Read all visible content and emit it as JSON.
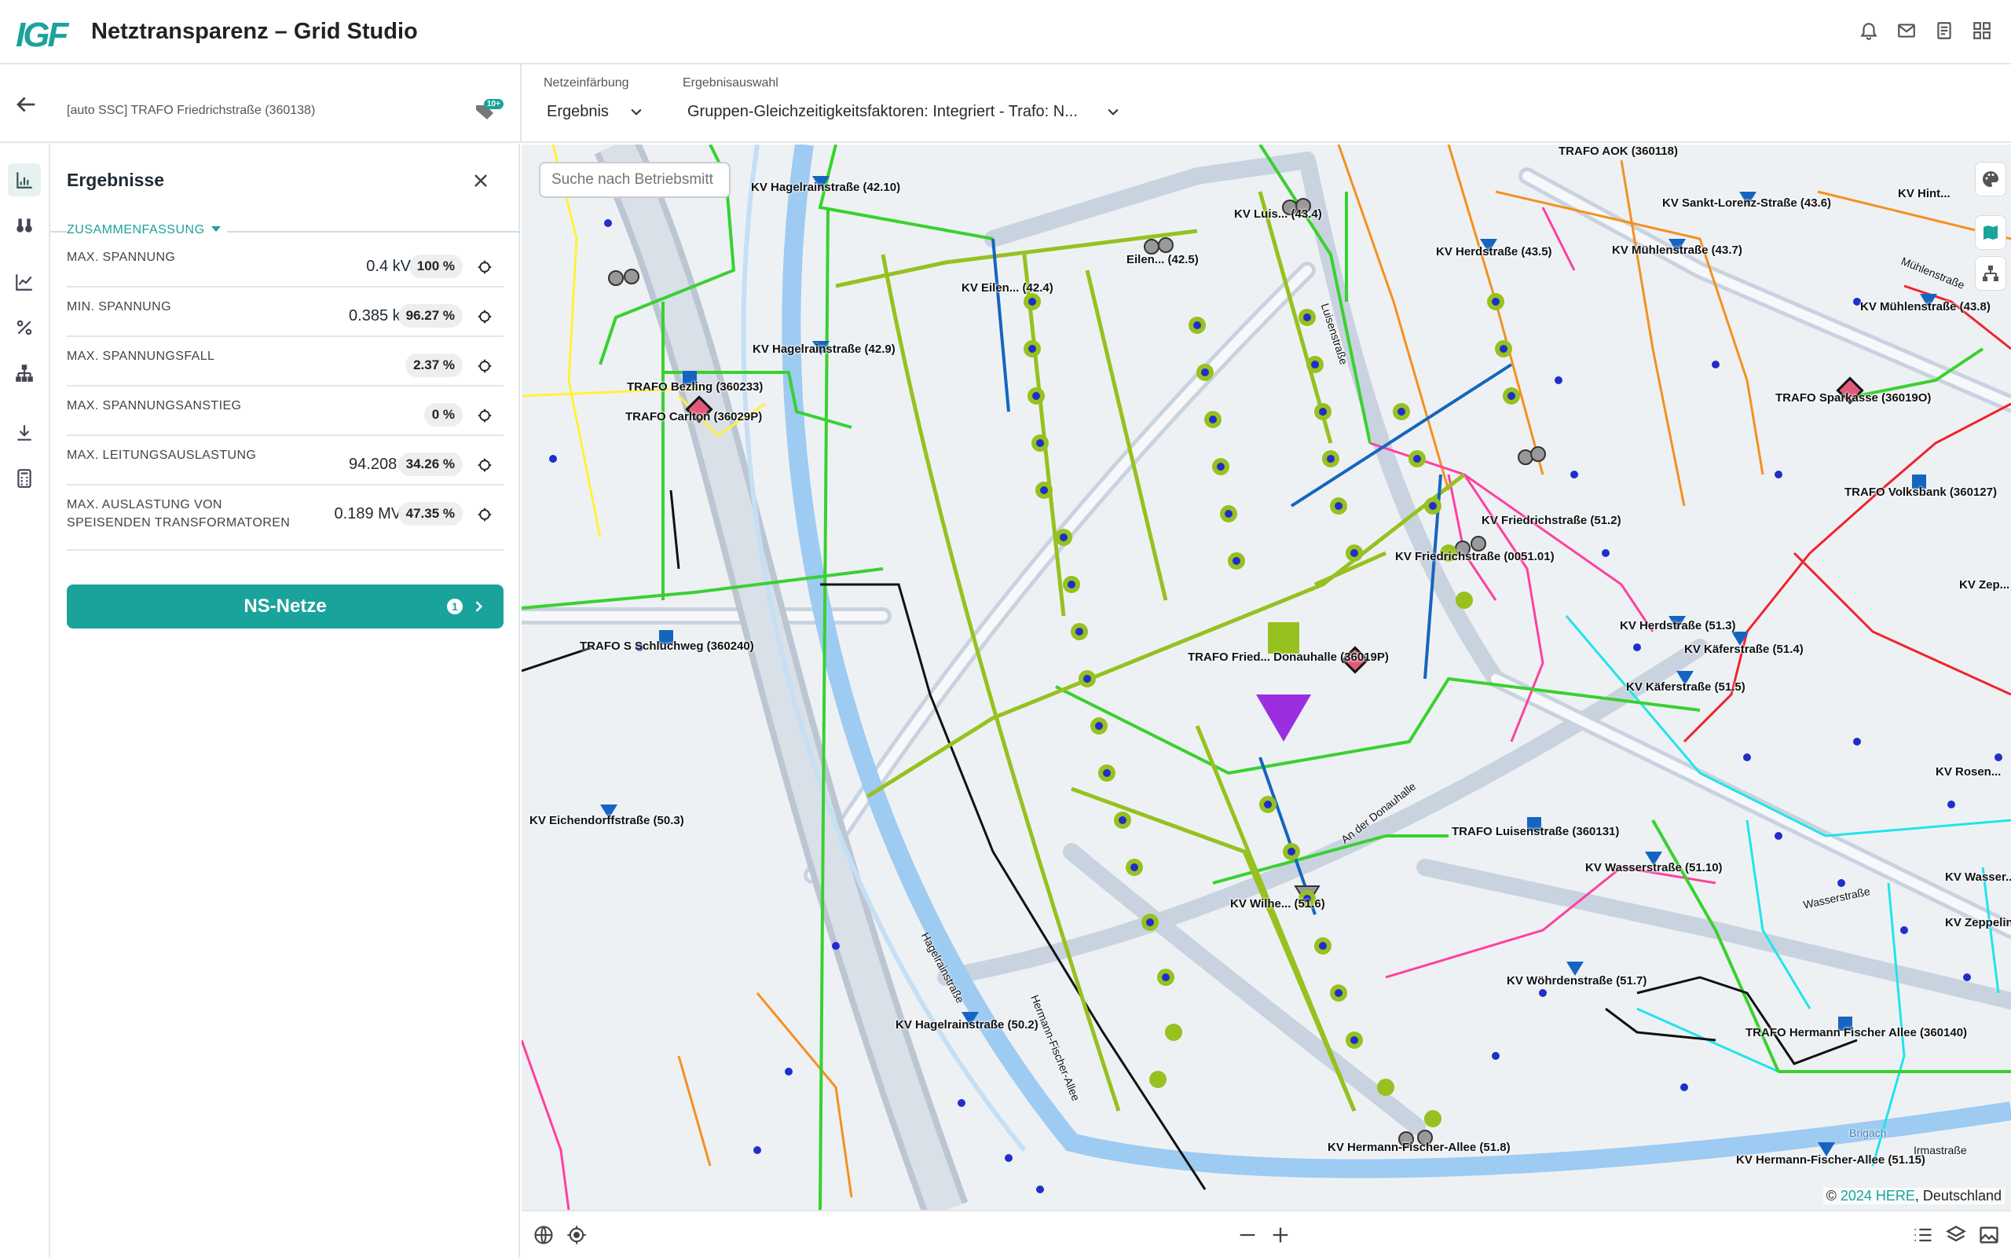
{
  "app": {
    "logo": "IGF",
    "title": "Netztransparenz – Grid Studio"
  },
  "header_icons": [
    "bell-icon",
    "mail-icon",
    "document-icon",
    "apps-grid-icon"
  ],
  "context": {
    "label": "[auto SSC] TRAFO Friedrichstraße (360138)",
    "badge": "10+"
  },
  "selectors": {
    "netzeinfaerbung": {
      "label": "Netzeinfärbung",
      "value": "Ergebnis"
    },
    "ergebnisauswahl": {
      "label": "Ergebnisauswahl",
      "value": "Gruppen-Gleichzeitigkeitsfaktoren: Integriert - Trafo: N..."
    }
  },
  "panel": {
    "title": "Ergebnisse",
    "section": "ZUSAMMENFASSUNG",
    "metrics": [
      {
        "label": "MAX. SPANNUNG",
        "value": "0.4 kV",
        "pct": "100 %"
      },
      {
        "label": "MIN. SPANNUNG",
        "value": "0.385 kV",
        "pct": "96.27 %"
      },
      {
        "label": "MAX. SPANNUNGSFALL",
        "value": "",
        "pct": "2.37 %"
      },
      {
        "label": "MAX. SPANNUNGSANSTIEG",
        "value": "",
        "pct": "0 %"
      },
      {
        "label": "MAX. LEITUNGSAUSLASTUNG",
        "value": "94.208 A",
        "pct": "34.26 %"
      },
      {
        "label": "MAX. AUSLASTUNG VON SPEISENDEN TRANSFORMATOREN",
        "label_line1": "MAX. AUSLASTUNG VON",
        "label_line2": "SPEISENDEN TRANSFORMATOREN",
        "value": "0.189 MVA",
        "pct": "47.35 %"
      }
    ],
    "ns_button": {
      "label": "NS-Netze",
      "count": "1"
    }
  },
  "map": {
    "search_placeholder": "Suche nach Betriebsmitt",
    "copyright_prefix": "© ",
    "copyright_brand": "2024 HERE",
    "copyright_suffix": ", Deutschland",
    "labels": {
      "l1": "KV Hagelrainstraße (42.10)",
      "l2": "KV Eilen... (42.4)",
      "l3": "Eilen... (42.5)",
      "l4": "KV Luis... (43.4)",
      "l5": "TRAFO AOK (360118)",
      "l6": "KV Sankt-Lorenz-Straße (43.6)",
      "l7": "KV Herdstraße (43.5)",
      "l8": "KV Mühlenstraße (43.7)",
      "l9": "KV Mühlenstraße (43.8)",
      "l10": "KV Hagelrainstraße (42.9)",
      "l11": "TRAFO Bezling (360233)",
      "l12": "TRAFO Carlton (36029P)",
      "l13": "TRAFO Sparkasse (36019O)",
      "l14": "TRAFO Volksbank (360127)",
      "l15": "KV Friedrichstraße (51.2)",
      "l16": "KV Friedrichstraße (0051.01)",
      "l17": "TRAFO S Schluchweg (360240)",
      "l18": "TRAFO Fried... Donauhalle (36019P)",
      "l19": "KV Herdstraße (51.3)",
      "l20": "KV Käferstraße (51.4)",
      "l21": "KV Käferstraße (51.5)",
      "l22": "KV Eichendorffstraße (50.3)",
      "l23": "TRAFO Luisenstraße (360131)",
      "l24": "KV Wasserstraße (51.10)",
      "l25": "KV Wilhe... (51.6)",
      "l26": "KV Wöhrdenstraße (51.7)",
      "l27": "KV Hagelrainstraße (50.2)",
      "l28": "TRAFO Hermann Fischer Allee (360140)",
      "l29": "KV Hermann-Fischer-Allee (51.8)",
      "l30": "KV Hermann-Fischer-Allee (51.15)",
      "l31": "KV Rosen...",
      "l32": "KV Zeppelin",
      "l33": "KV Wasser...",
      "l34": "KV Hint...",
      "l35": "KV Zep..."
    },
    "streets": {
      "s1": "Hermann-Fischer-Allee",
      "s2": "Hagelrainstraße",
      "s3": "Luisenstraße",
      "s4": "An der Donauhalle",
      "s5": "Wasserstraße",
      "s6": "Brigach",
      "s7": "Mühlenstraße",
      "s8": "Irmastraße"
    },
    "colors": {
      "green": "#39d12f",
      "olive": "#96c11f",
      "blue": "#1565c0",
      "orange": "#f5901e",
      "pink": "#ff3fa0",
      "cyan": "#1fe4ec",
      "red": "#f0232d",
      "yellow": "#fff23a",
      "river": "#9dcbf2"
    }
  },
  "bottom_bar": [
    "globe-icon",
    "locate-icon",
    "zoom-out-icon",
    "zoom-in-icon",
    "list-icon",
    "layers-icon",
    "image-icon"
  ]
}
